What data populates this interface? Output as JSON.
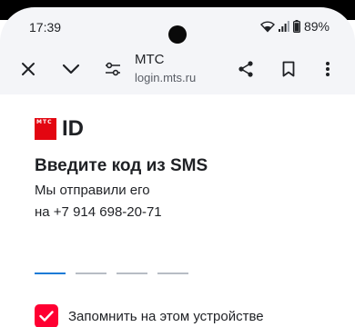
{
  "status_bar": {
    "time": "17:39",
    "battery": "89%"
  },
  "browser": {
    "site_title": "МТС",
    "site_url": "login.mts.ru",
    "icons": [
      "close-icon",
      "chevron-down-icon",
      "tune-icon",
      "share-icon",
      "bookmark-icon",
      "more-vert-icon"
    ]
  },
  "page": {
    "logo_badge": "МТС",
    "logo_text": "ID",
    "heading": "Введите код из SMS",
    "desc_line1": "Мы отправили его",
    "desc_line2": "на +7 914 698-20-71",
    "code_slots": 4,
    "remember_label": "Запомнить на этом устройстве",
    "remember_checked": true
  },
  "colors": {
    "brand_red": "#e30611",
    "checkbox_red": "#ff0032",
    "active_slot": "#1a7bd6",
    "inactive_slot": "#b7bcc4"
  }
}
